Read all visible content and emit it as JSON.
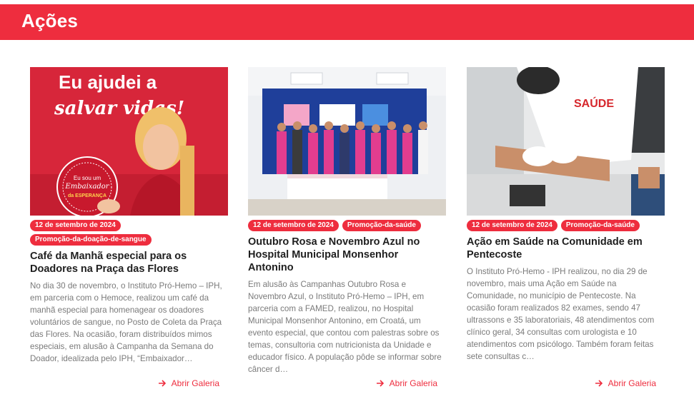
{
  "header": {
    "title": "Ações"
  },
  "colors": {
    "accent": "#ee2d3e"
  },
  "cards": [
    {
      "image_text_line1": "Eu ajudei a",
      "image_text_line2": "salvar vidas!",
      "image_badge_line1": "Eu sou um",
      "image_badge_line2": "Embaixador",
      "image_badge_line3": "da ESPERANÇA",
      "date": "12 de setembro de 2024",
      "category": "Promoção-da-doação-de-sangue",
      "title": "Café da Manhã especial para os Doadores na Praça das Flores",
      "excerpt": "No dia 30 de novembro, o Instituto Pró-Hemo – IPH, em parceria com o Hemoce, realizou um café da manhã especial para homenagear os doadores voluntários de sangue, no Posto de Coleta da Praça das Flores. Na ocasião, foram distribuídos mimos especiais, em alusão à Campanha da Semana do Doador, idealizada pelo IPH, “Embaixador…",
      "link": "Abrir Galeria"
    },
    {
      "date": "12 de setembro de 2024",
      "category": "Promoção-da-saúde",
      "title": "Outubro Rosa e Novembro Azul no Hospital Municipal Monsenhor Antonino",
      "excerpt": "Em alusão às Campanhas Outubro Rosa e Novembro Azul, o Instituto Pró-Hemo – IPH, em parceria com a FAMED, realizou, no Hospital Municipal Monsenhor Antonino, em Croatá, um evento especial, que contou com palestras sobre os temas, consultoria com nutricionista da Unidade e educador físico. A população pôde se informar sobre câncer d…",
      "link": "Abrir Galeria"
    },
    {
      "image_text": "SAÚDE",
      "date": "12 de setembro de 2024",
      "category": "Promoção-da-saúde",
      "title": "Ação em Saúde na Comunidade em Pentecoste",
      "excerpt": "O Instituto Pró-Hemo - IPH realizou, no dia 29 de novembro, mais uma Ação em Saúde na Comunidade, no município de Pentecoste. Na ocasião foram realizados 82 exames, sendo 47 ultrassons e 35 laboratoriais, 48 atendimentos com clínico geral, 34 consultas com urologista e 10 atendimentos com psicólogo. Também foram feitas sete consultas c…",
      "link": "Abrir Galeria"
    }
  ]
}
